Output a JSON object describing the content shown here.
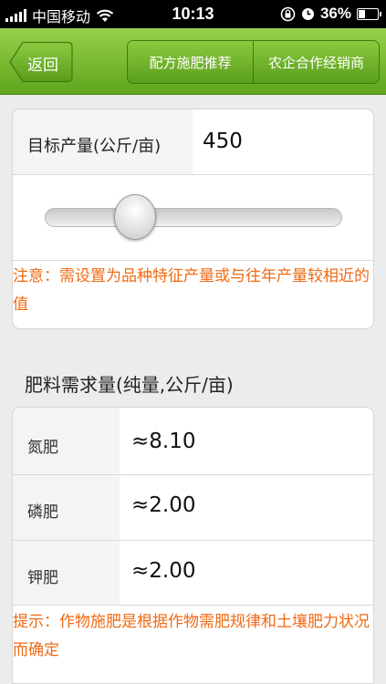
{
  "status_bar": {
    "carrier": "中国移动",
    "time": "10:13",
    "battery_percent": "36%",
    "battery_level": 0.36,
    "icons": [
      "signal-icon",
      "wifi-icon",
      "orientation-lock-icon",
      "alarm-icon",
      "battery-icon"
    ]
  },
  "navbar": {
    "back_label": "返回",
    "tabs": [
      "配方施肥推荐",
      "农企合作经销商"
    ],
    "colors": {
      "bar": "#76bb33",
      "border": "#3f7a0f"
    }
  },
  "target": {
    "label": "目标产量(公斤/亩)",
    "value": "450",
    "note": "注意：需设置为品种特征产量或与往年产量较相近的值"
  },
  "slider": {
    "fraction": 0.27
  },
  "requirements": {
    "title": "肥料需求量(纯量,公斤/亩)",
    "rows": [
      {
        "label": "氮肥",
        "value": "≈8.10"
      },
      {
        "label": "磷肥",
        "value": "≈2.00"
      },
      {
        "label": "钾肥",
        "value": "≈2.00"
      }
    ],
    "note": "提示：作物施肥是根据作物需肥规律和土壤肥力状况而确定"
  },
  "accent_colors": {
    "note_text": "#f06a14"
  }
}
